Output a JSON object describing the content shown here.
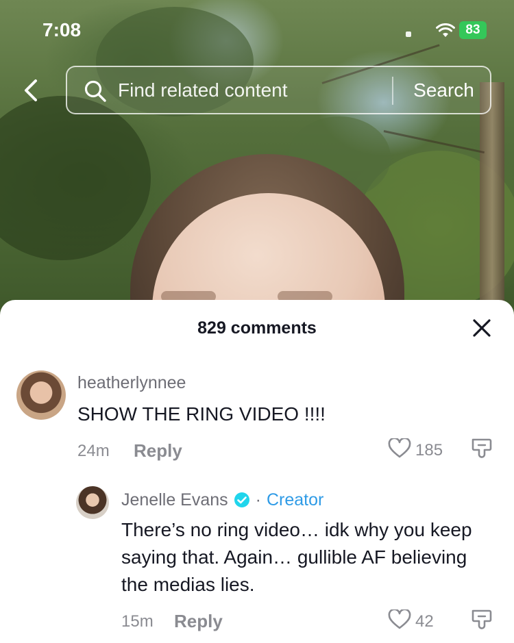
{
  "status_bar": {
    "time": "7:08",
    "battery": "83"
  },
  "search": {
    "placeholder": "Find related content",
    "button_label": "Search"
  },
  "comments_sheet": {
    "title": "829 comments",
    "comments": [
      {
        "username": "heatherlynnee",
        "text": "SHOW THE RING VIDEO !!!!",
        "time": "24m",
        "reply_label": "Reply",
        "likes": "185"
      },
      {
        "username": "Jenelle Evans",
        "separator": "·",
        "badge": "Creator",
        "text": "There’s no ring video… idk why you keep saying that. Again… gullible AF believing the medias lies.",
        "time": "15m",
        "reply_label": "Reply",
        "likes": "42"
      }
    ]
  },
  "colors": {
    "battery": "#34c759",
    "creator_label": "#2f9be6",
    "verified_badge": "#20d5ec",
    "primary_text": "#161823",
    "secondary_text": "#8a8b91"
  },
  "icons": [
    "back-arrow-icon",
    "search-icon",
    "wifi-icon",
    "close-icon",
    "heart-icon",
    "dislike-icon",
    "verified-badge-icon"
  ]
}
